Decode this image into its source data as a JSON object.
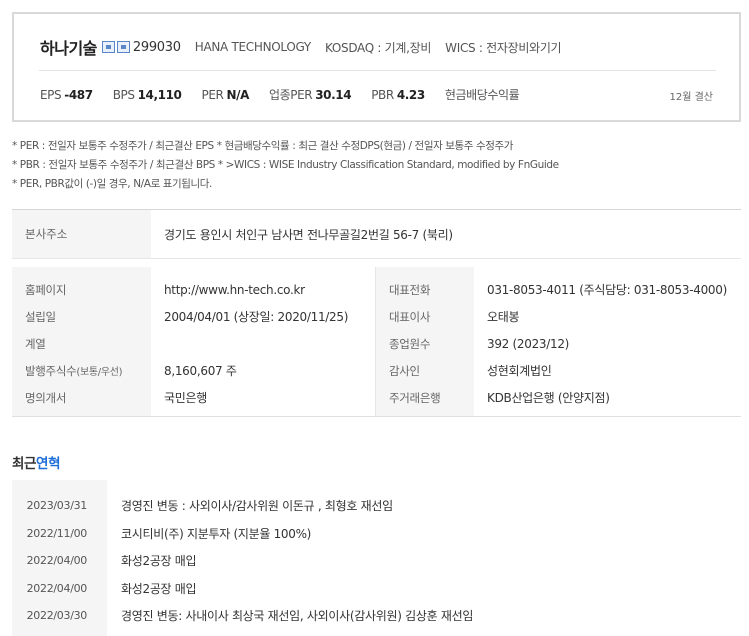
{
  "summary": {
    "company_name": "하나기술",
    "code": "299030",
    "english_name": "HANA TECHNOLOGY",
    "market": "KOSDAQ : 기계,장비",
    "wics": "WICS : 전자장비와기기",
    "metrics": [
      {
        "label": "EPS",
        "value": "-487"
      },
      {
        "label": "BPS",
        "value": "14,110"
      },
      {
        "label": "PER",
        "value": "N/A"
      },
      {
        "label": "업종PER",
        "value": "30.14"
      },
      {
        "label": "PBR",
        "value": "4.23"
      },
      {
        "label": "현금배당수익률",
        "value": ""
      }
    ],
    "settlement": "12월 결산"
  },
  "notes": [
    "* PER : 전일자 보통주 수정주가 / 최근결산 EPS * 현금배당수익률 : 최근 결산 수정DPS(현금) / 전일자 보통주 수정주가",
    "* PBR : 전일자 보통주 수정주가 / 최근결산 BPS * >WICS : WISE Industry Classification Standard, modified by FnGuide",
    "* PER, PBR값이 (-)일 경우, N/A로 표기됩니다."
  ],
  "address": {
    "label": "본사주소",
    "value": "경기도 용인시 처인구 남사면 전나무골길2번길 56-7 (북리)"
  },
  "left_info": [
    {
      "label": "홈페이지",
      "value": "http://www.hn-tech.co.kr"
    },
    {
      "label": "설립일",
      "value": "2004/04/01 (상장일: 2020/11/25)"
    },
    {
      "label": "계열",
      "value": ""
    },
    {
      "label": "발행주식수",
      "label_small": "(보통/우선)",
      "value": "8,160,607 주"
    },
    {
      "label": "명의개서",
      "value": "국민은행"
    }
  ],
  "right_info": [
    {
      "label": "대표전화",
      "value": "031-8053-4011 (주식담당: 031-8053-4000)"
    },
    {
      "label": "대표이사",
      "value": "오태봉"
    },
    {
      "label": "종업원수",
      "value": "392 (2023/12)"
    },
    {
      "label": "감사인",
      "value": "성현회계법인"
    },
    {
      "label": "주거래은행",
      "value": "KDB산업은행 (안양지점)"
    }
  ],
  "history": {
    "title_prefix": "최근",
    "title_accent": "연혁",
    "items": [
      {
        "date": "2023/03/31",
        "text": "경영진 변동 : 사외이사/감사위원 이돈규 , 최형호 재선임"
      },
      {
        "date": "2022/11/00",
        "text": "코시티비(주) 지분투자 (지분율 100%)"
      },
      {
        "date": "2022/04/00",
        "text": "화성2공장 매입"
      },
      {
        "date": "2022/04/00",
        "text": "화성2공장 매입"
      },
      {
        "date": "2022/03/30",
        "text": "경영진 변동: 사내이사 최상국 재선임, 사외이사(감사위원) 김상훈 재선임"
      }
    ]
  },
  "colors": {
    "accent": "#1e6fd9",
    "label_bg": "#f5f5f5",
    "border": "#d9d9d9"
  }
}
